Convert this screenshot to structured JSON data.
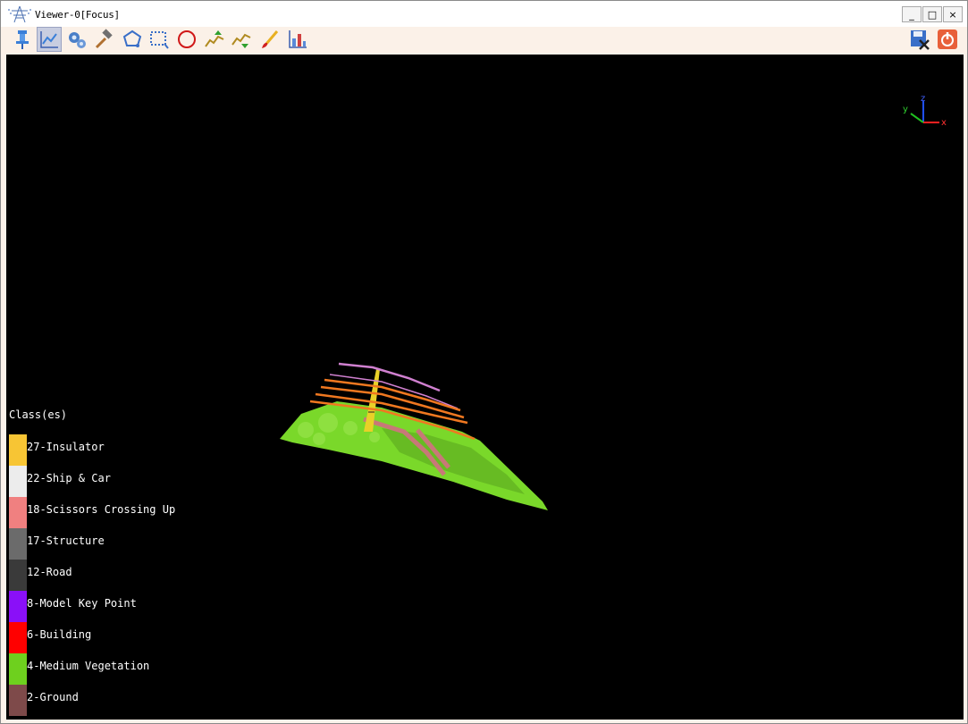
{
  "window": {
    "title": "Viewer-0[Focus]",
    "controls": {
      "minimize": "_",
      "maximize": "□",
      "close": "×"
    }
  },
  "toolbar": {
    "tools": [
      {
        "name": "pin-icon",
        "active": false
      },
      {
        "name": "line-chart-icon",
        "active": true
      },
      {
        "name": "gears-icon",
        "active": false
      },
      {
        "name": "hammer-icon",
        "active": false
      },
      {
        "name": "polygon-select-icon",
        "active": false
      },
      {
        "name": "rectangle-select-icon",
        "active": false
      },
      {
        "name": "circle-select-icon",
        "active": false
      },
      {
        "name": "profile-up-icon",
        "active": false
      },
      {
        "name": "profile-down-icon",
        "active": false
      },
      {
        "name": "brush-icon",
        "active": false
      },
      {
        "name": "chart-tool-icon",
        "active": false
      }
    ],
    "right_tools": [
      {
        "name": "save-close-icon"
      },
      {
        "name": "power-icon"
      }
    ]
  },
  "axes": {
    "x": "x",
    "y": "y",
    "z": "z"
  },
  "legend": {
    "title": "Class(es)",
    "items": [
      {
        "label": "27-Insulator",
        "color": "#f7c534"
      },
      {
        "label": "22-Ship & Car",
        "color": "#ececec"
      },
      {
        "label": "18-Scissors Crossing Up",
        "color": "#f08080"
      },
      {
        "label": "17-Structure",
        "color": "#6b6b6b"
      },
      {
        "label": "12-Road",
        "color": "#3a3a3a"
      },
      {
        "label": "8-Model Key Point",
        "color": "#8a10f8"
      },
      {
        "label": "6-Building",
        "color": "#ff0000"
      },
      {
        "label": "4-Medium Vegetation",
        "color": "#6ed01e"
      },
      {
        "label": "2-Ground",
        "color": "#7e4a4a"
      }
    ]
  },
  "colors": {
    "viewport_bg": "#000000",
    "toolbar_bg": "#fbf1e8",
    "vegetation": "#7ad82a",
    "tower": "#e8d028",
    "wire_orange": "#f07820",
    "wire_pink": "#d080d0"
  }
}
